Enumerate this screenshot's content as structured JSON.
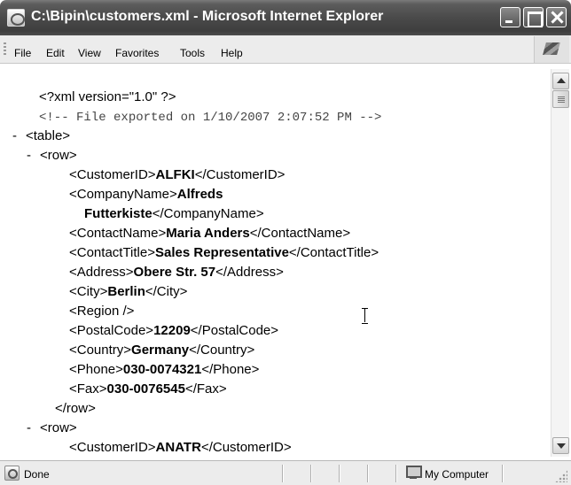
{
  "window": {
    "title": "C:\\Bipin\\customers.xml - Microsoft Internet Explorer"
  },
  "menu": {
    "file": "File",
    "edit": "Edit",
    "view": "View",
    "favorites": "Favorites",
    "tools": "Tools",
    "help": "Help"
  },
  "xml": {
    "declaration": "<?xml version=\"1.0\" ?>",
    "comment": "<!-- File exported on 1/10/2007 2:07:52 PM -->",
    "minus": "-",
    "table_open": "<table>",
    "row_open": "<row>",
    "row_close": "</row>",
    "row2_open": "<row>",
    "fields": [
      {
        "open": "<CustomerID>",
        "value": "ALFKI",
        "close": "</CustomerID>"
      },
      {
        "open": "<CompanyName>",
        "value": "Alfreds",
        "value2": "Futterkiste",
        "close": "</CompanyName>"
      },
      {
        "open": "<ContactName>",
        "value": "Maria Anders",
        "close": "</ContactName>"
      },
      {
        "open": "<ContactTitle>",
        "value": "Sales Representative",
        "close": "</ContactTitle>"
      },
      {
        "open": "<Address>",
        "value": "Obere Str. 57",
        "close": "</Address>"
      },
      {
        "open": "<City>",
        "value": "Berlin",
        "close": "</City>"
      },
      {
        "empty": "<Region />"
      },
      {
        "open": "<PostalCode>",
        "value": "12209",
        "close": "</PostalCode>"
      },
      {
        "open": "<Country>",
        "value": "Germany",
        "close": "</Country>"
      },
      {
        "open": "<Phone>",
        "value": "030-0074321",
        "close": "</Phone>"
      },
      {
        "open": "<Fax>",
        "value": "030-0076545",
        "close": "</Fax>"
      }
    ],
    "row2_first": {
      "open": "<CustomerID>",
      "value": "ANATR",
      "close": "</CustomerID>"
    }
  },
  "status": {
    "text": "Done",
    "zone": "My Computer"
  }
}
